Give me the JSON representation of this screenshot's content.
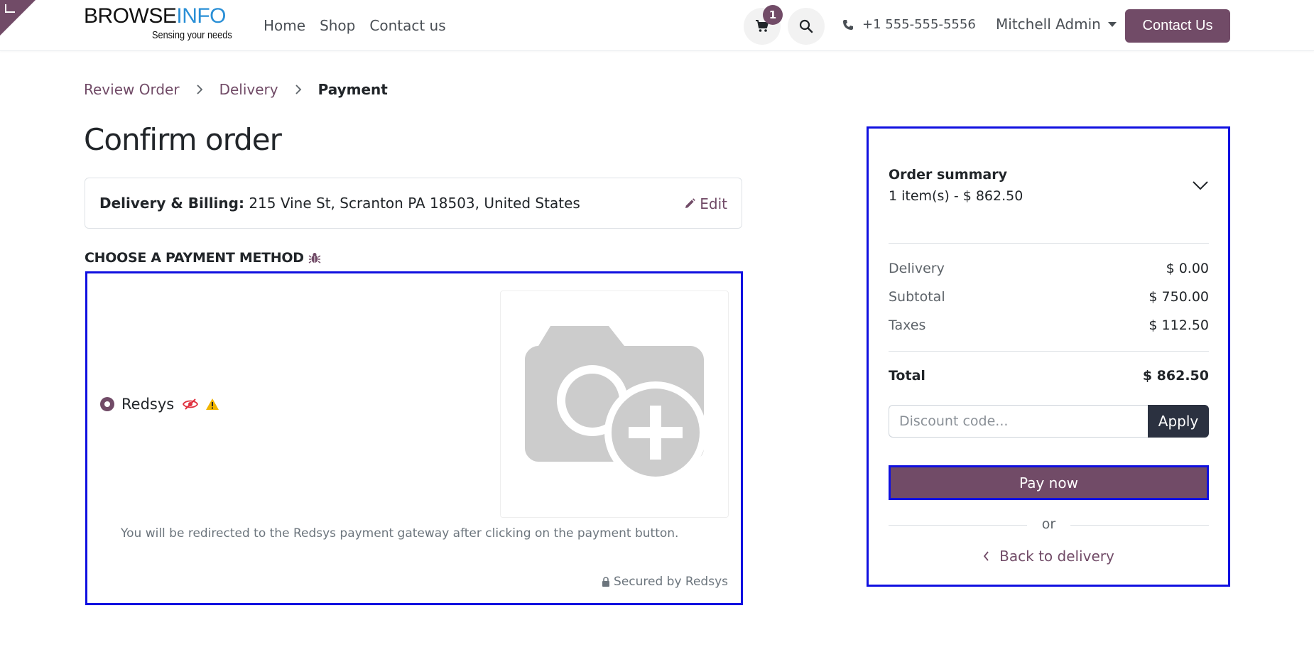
{
  "header": {
    "logo_browse": "BROWSE",
    "logo_info": "INFO",
    "logo_tagline": "Sensing your needs",
    "nav": [
      "Home",
      "Shop",
      "Contact us"
    ],
    "cart_count": "1",
    "phone": "+1 555-555-5556",
    "user_name": "Mitchell Admin",
    "contact_button": "Contact Us"
  },
  "breadcrumb": [
    "Review Order",
    "Delivery",
    "Payment"
  ],
  "page_title": "Confirm order",
  "address": {
    "label": "Delivery & Billing:",
    "value": "215 Vine St, Scranton PA 18503, United States",
    "edit": "Edit"
  },
  "payment": {
    "heading": "CHOOSE A PAYMENT METHOD",
    "provider": "Redsys",
    "redirect_note": "You will be redirected to the Redsys payment gateway after clicking on the payment button.",
    "secured": "Secured by Redsys"
  },
  "summary": {
    "title": "Order summary",
    "count": "1 item(s) -  $ 862.50",
    "rows": [
      {
        "label": "Delivery",
        "amount": "$ 0.00"
      },
      {
        "label": "Subtotal",
        "amount": "$ 750.00"
      },
      {
        "label": "Taxes",
        "amount": "$ 112.50"
      }
    ],
    "total_label": "Total",
    "total_amount": "$ 862.50",
    "discount_placeholder": "Discount code...",
    "apply": "Apply",
    "pay_now": "Pay now",
    "or": "or",
    "back": "Back to delivery"
  },
  "colors": {
    "brand": "#714b67",
    "highlight": "#1010e0",
    "logo_blue": "#2a8fd6",
    "apply_bg": "#2b3140"
  }
}
